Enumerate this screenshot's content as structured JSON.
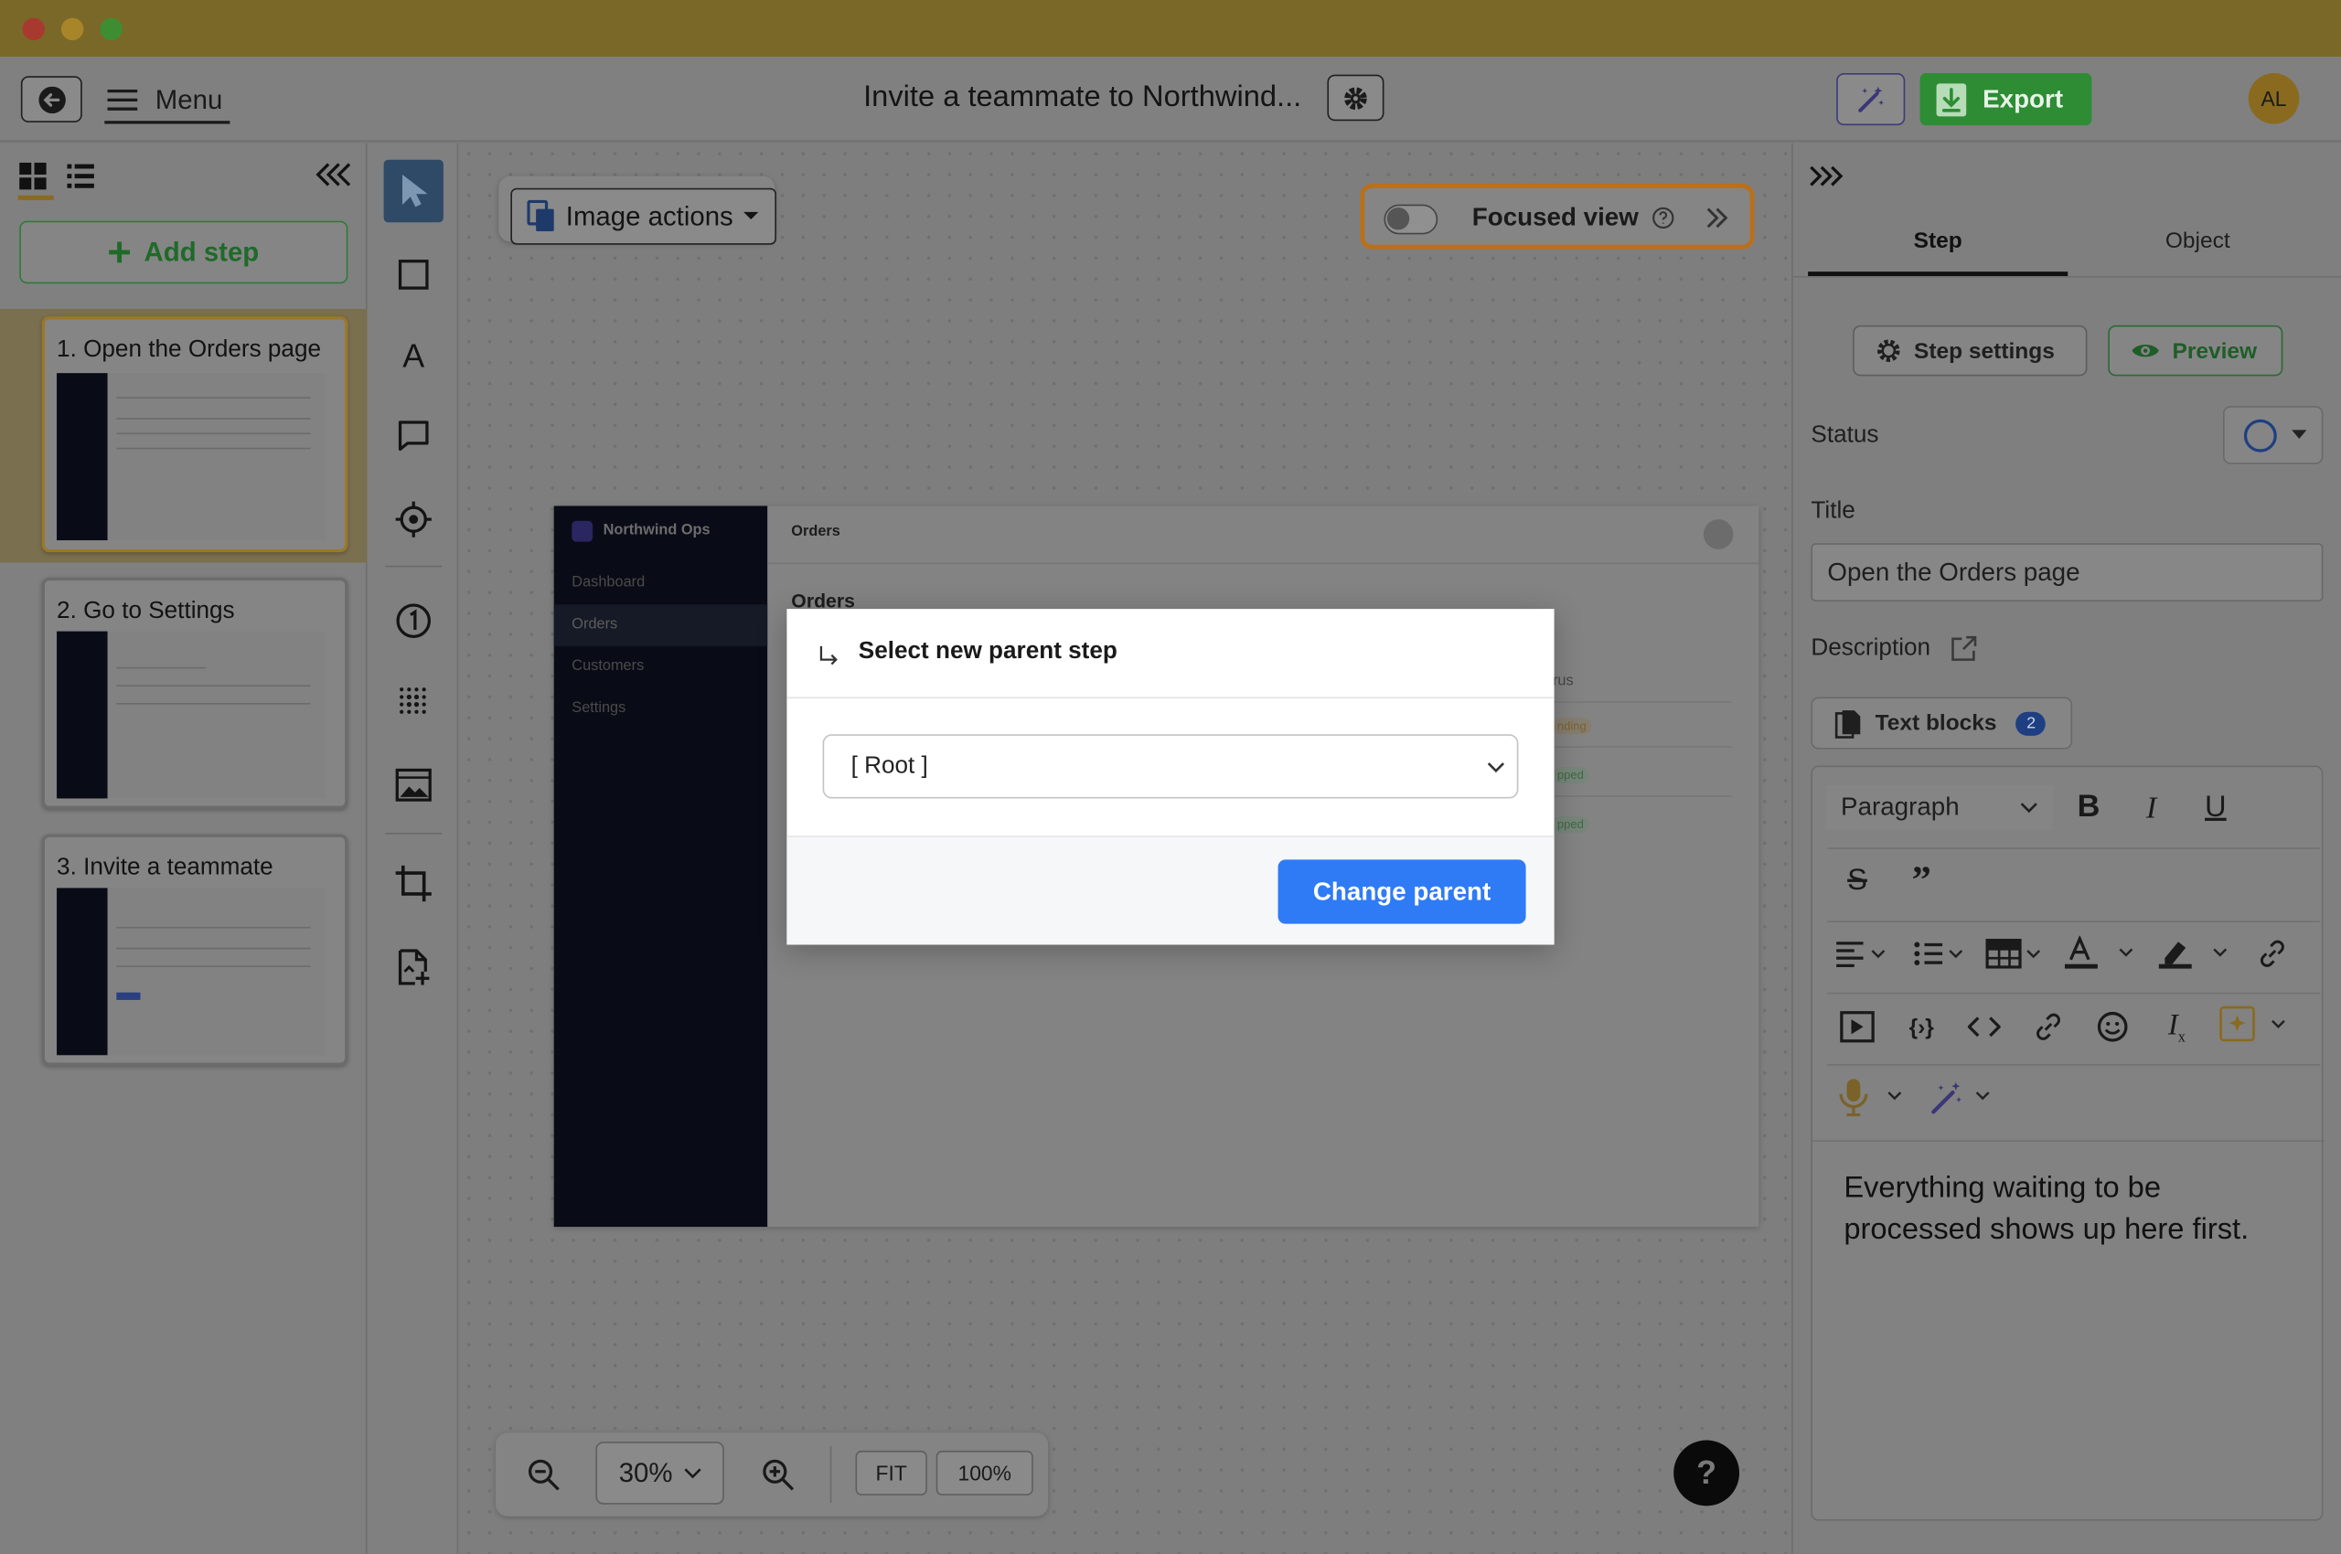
{
  "window": {
    "title": "Invite a teammate to Northwind...",
    "user_initials": "AL"
  },
  "toolbar": {
    "menu_label": "Menu",
    "export_label": "Export"
  },
  "left_panel": {
    "add_step_label": "Add step",
    "steps": [
      {
        "label": "1. Open the Orders page",
        "selected": true
      },
      {
        "label": "2. Go to Settings",
        "selected": false
      },
      {
        "label": "3. Invite a teammate",
        "selected": false
      }
    ]
  },
  "canvas": {
    "image_actions_label": "Image actions",
    "focused_view_label": "Focused view",
    "zoom": {
      "level": "30%",
      "fit_label": "FIT",
      "actual_label": "100%"
    },
    "help_label": "?",
    "screenshot": {
      "app_name": "Northwind Ops",
      "nav": [
        "Dashboard",
        "Orders",
        "Customers",
        "Settings"
      ],
      "active_nav": "Orders",
      "header": "Orders",
      "page_heading": "Orders",
      "column_fragment": "rus",
      "status_fragments": [
        "nding",
        "pped",
        "pped"
      ]
    }
  },
  "modal": {
    "title": "Select new parent step",
    "select_value": "[ Root ]",
    "submit_label": "Change parent"
  },
  "right_panel": {
    "tabs": [
      {
        "label": "Step",
        "active": true
      },
      {
        "label": "Object",
        "active": false
      }
    ],
    "step_settings_label": "Step settings",
    "preview_label": "Preview",
    "status_label": "Status",
    "title_label": "Title",
    "title_value": "Open the Orders page",
    "description_label": "Description",
    "text_blocks_label": "Text blocks",
    "text_blocks_count": "2",
    "paragraph_style": "Paragraph",
    "description_text": "Everything waiting to be processed shows up here first."
  },
  "colors": {
    "accent_blue": "#2f7bf5",
    "export_green": "#2d8c34",
    "focused_outline": "#d97f1a",
    "avatar": "#e0a62c"
  }
}
